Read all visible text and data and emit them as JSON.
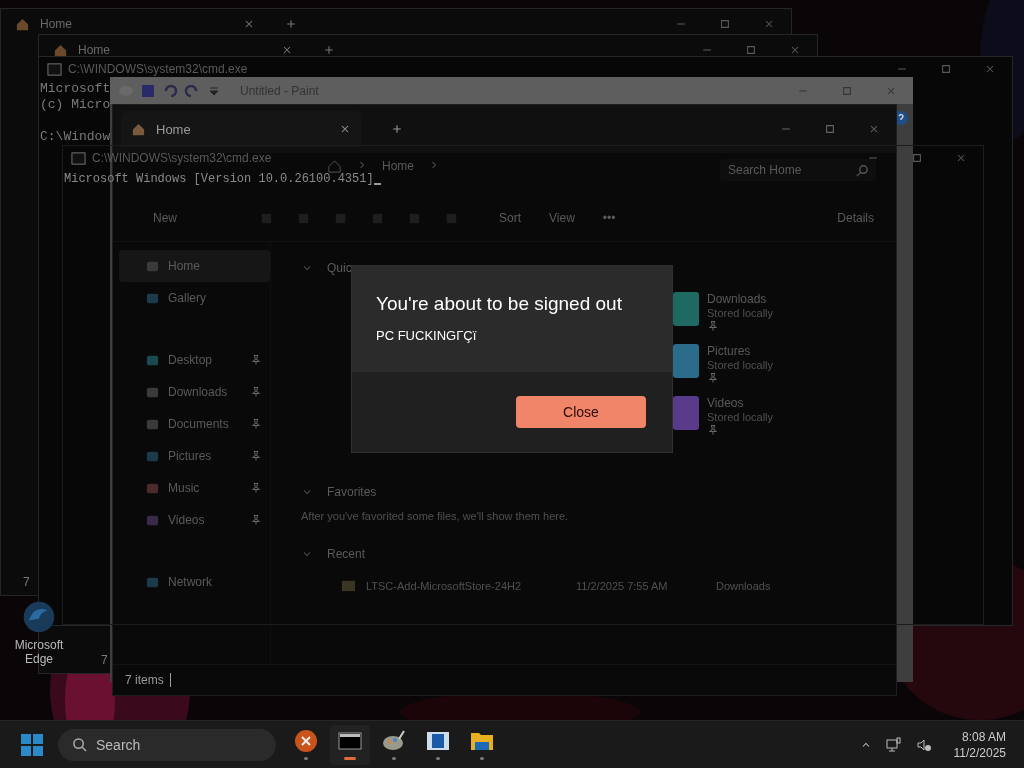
{
  "desktop": {
    "icons": [
      {
        "label": "Microsoft Edge"
      }
    ]
  },
  "background_windows": [
    {
      "kind": "explorer",
      "tab": "Home",
      "status": "7"
    },
    {
      "kind": "explorer",
      "tab": "Home",
      "status": "7"
    },
    {
      "kind": "cmd",
      "title": "C:\\WINDOWS\\system32\\cmd.exe",
      "lines": [
        {
          "text": "Microsoft",
          "gap_before": false
        },
        {
          "text": "(c) Micro",
          "gap_before": false
        },
        {
          "text": "C:\\Window",
          "gap_before": true
        }
      ]
    }
  ],
  "paint": {
    "title": "Untitled - Paint"
  },
  "explorer": {
    "tab": "Home",
    "breadcrumb": "Home",
    "search": {
      "placeholder": "Search Home"
    },
    "toolbar": [
      {
        "kind": "new",
        "label": "New"
      },
      {
        "kind": "sort",
        "label": "Sort"
      },
      {
        "kind": "view",
        "label": "View"
      },
      {
        "kind": "more",
        "label": "•••"
      },
      {
        "kind": "details",
        "label": "Details"
      }
    ],
    "sidebar": {
      "groups": [
        {
          "items": [
            {
              "label": "Home",
              "pinned": false,
              "selected": true
            },
            {
              "label": "Gallery",
              "pinned": false,
              "selected": false
            }
          ]
        },
        {
          "items": [
            {
              "label": "Desktop",
              "pinned": true,
              "selected": false
            },
            {
              "label": "Downloads",
              "pinned": true,
              "selected": false
            },
            {
              "label": "Documents",
              "pinned": true,
              "selected": false
            },
            {
              "label": "Pictures",
              "pinned": true,
              "selected": false
            },
            {
              "label": "Music",
              "pinned": true,
              "selected": false
            },
            {
              "label": "Videos",
              "pinned": true,
              "selected": false
            }
          ]
        },
        {
          "items": [
            {
              "label": "Network",
              "pinned": false,
              "selected": false
            }
          ]
        }
      ]
    },
    "quick_access": {
      "title": "Quic",
      "tiles": [
        {
          "name": "Downloads",
          "sub": "Stored locally",
          "color": "#1e6a62"
        },
        {
          "name": "Pictures",
          "sub": "Stored locally",
          "color": "#2a6c8a"
        },
        {
          "name": "Videos",
          "sub": "Stored locally",
          "color": "#5a3a8a"
        }
      ]
    },
    "favorites": {
      "title": "Favorites",
      "message": "After you've favorited some files, we'll show them here."
    },
    "recent": {
      "title": "Recent",
      "rows": [
        {
          "name": "LTSC-Add-MicrosoftStore-24H2",
          "date": "11/2/2025 7:55 AM",
          "location": "Downloads"
        }
      ]
    },
    "status": "7 items"
  },
  "cmd": {
    "title": "C:\\WINDOWS\\system32\\cmd.exe",
    "lines": [
      "Microsoft Windows [Version 10.0.26100.4351]"
    ]
  },
  "dialog": {
    "title": "You're about to be signed out",
    "message": "PC FUCKINGΓÇï",
    "buttons": [
      "Close"
    ]
  },
  "taskbar": {
    "search": {
      "placeholder": "Search"
    },
    "apps": [
      {
        "kind": "stop",
        "running": false
      },
      {
        "kind": "terminal",
        "running": true
      },
      {
        "kind": "paint",
        "running": false
      },
      {
        "kind": "window",
        "running": false
      },
      {
        "kind": "folder",
        "running": false
      }
    ],
    "time": "8:08 AM",
    "date": "11/2/2025"
  }
}
